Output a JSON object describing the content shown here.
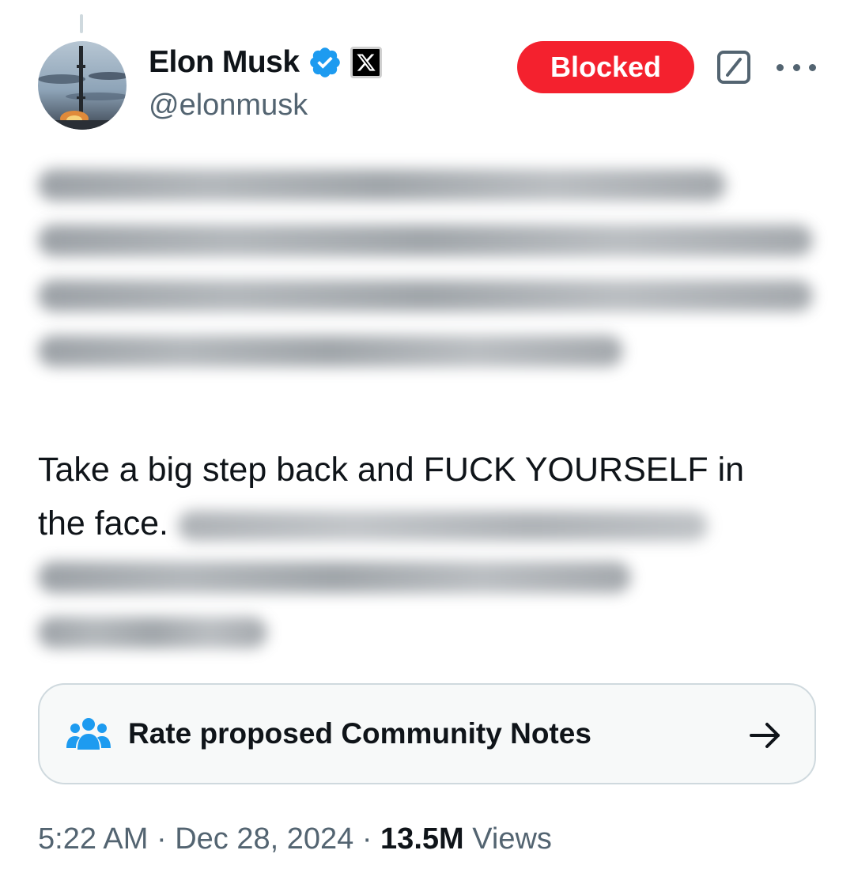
{
  "tweet": {
    "author": {
      "display_name": "Elon Musk",
      "handle": "@elonmusk",
      "verified": true,
      "verified_icon": "verified-badge-icon",
      "affiliate_icon": "x-logo-icon",
      "verified_color": "#1d9bf0"
    },
    "header_actions": {
      "blocked_label": "Blocked",
      "blocked_color": "#f4212e",
      "grok_icon": "grok-icon",
      "more_icon": "more-icon"
    },
    "text": {
      "visible_line_1": "Take a big step back and FUCK YOURSELF in",
      "visible_line_2": "the face."
    },
    "community_notes": {
      "label": "Rate proposed Community Notes",
      "icon": "people-icon",
      "arrow_icon": "arrow-right-icon",
      "icon_color": "#1d9bf0"
    },
    "meta": {
      "time": "5:22 AM",
      "separator": "·",
      "date": "Dec 28, 2024",
      "views_count": "13.5M",
      "views_label": "Views"
    }
  }
}
